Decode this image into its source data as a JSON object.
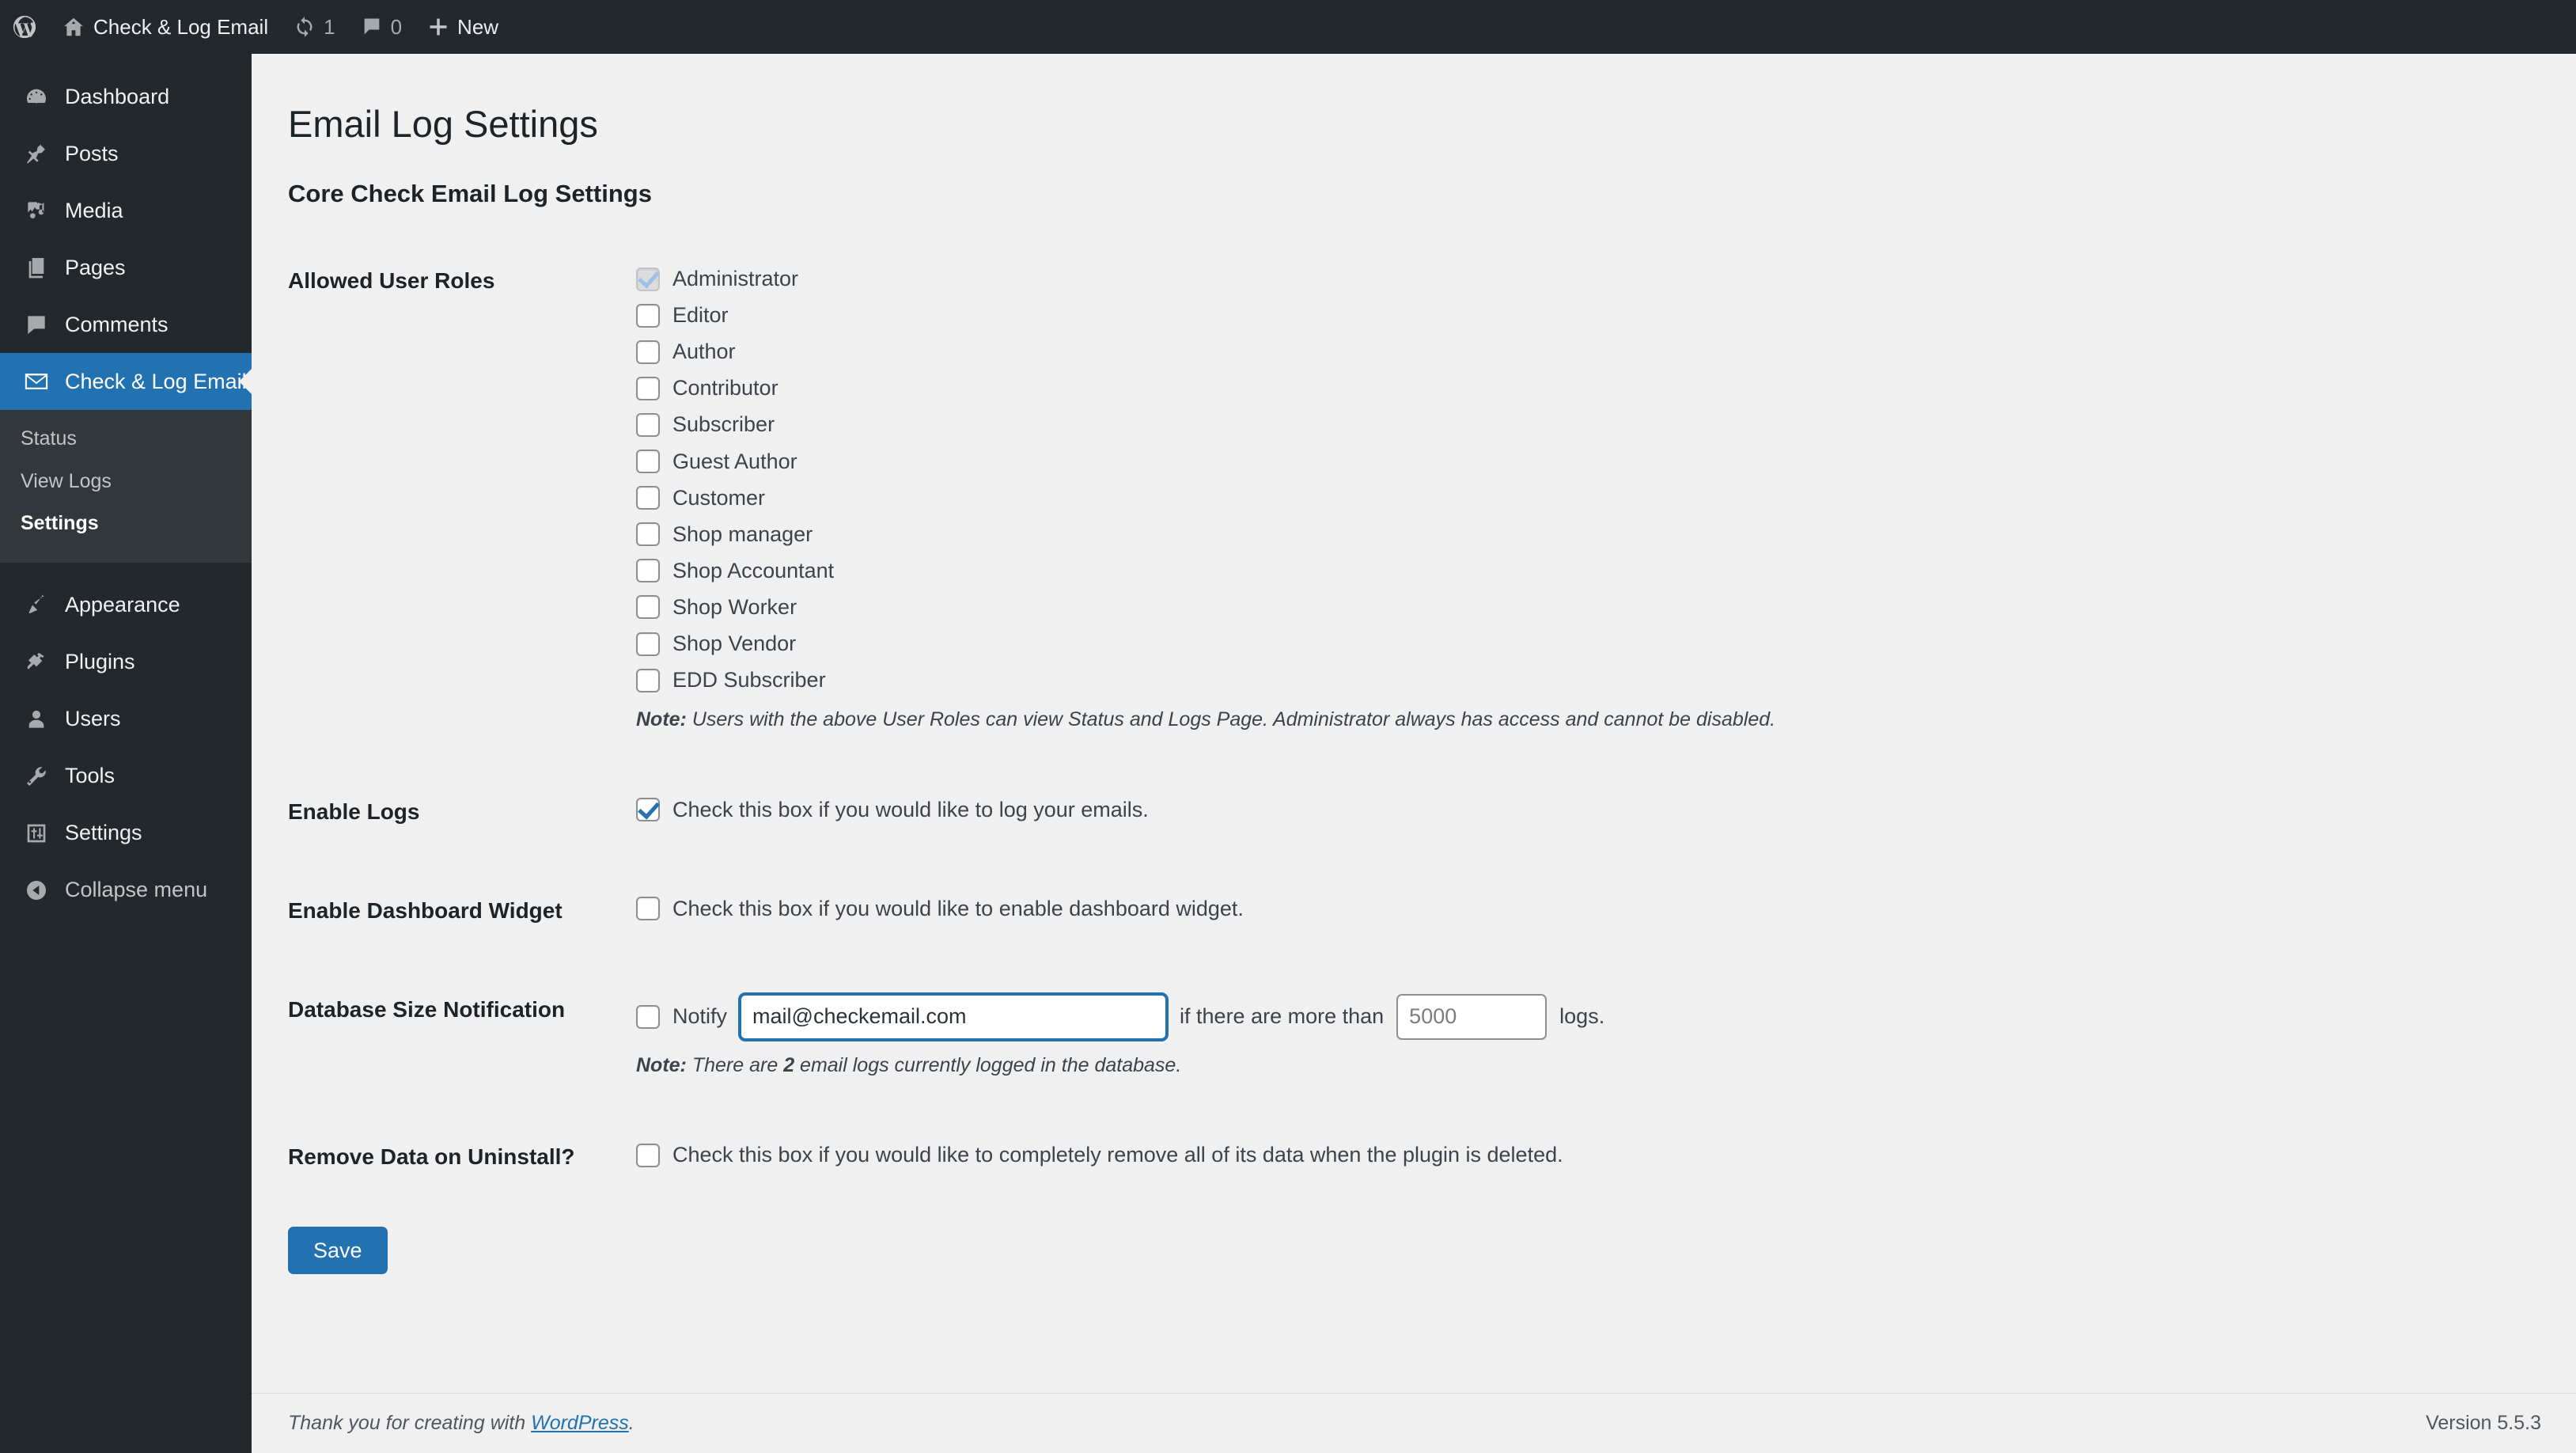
{
  "adminbar": {
    "site_name": "Check & Log Email",
    "updates_count": "1",
    "comments_count": "0",
    "new_label": "New"
  },
  "sidebar": {
    "items": [
      {
        "label": "Dashboard",
        "icon": "dashboard-icon",
        "current": false
      },
      {
        "label": "Posts",
        "icon": "pin-icon",
        "current": false
      },
      {
        "label": "Media",
        "icon": "media-icon",
        "current": false
      },
      {
        "label": "Pages",
        "icon": "pages-icon",
        "current": false
      },
      {
        "label": "Comments",
        "icon": "comments-icon",
        "current": false
      },
      {
        "label": "Check & Log Email",
        "icon": "email-icon",
        "current": true
      },
      {
        "label": "Appearance",
        "icon": "brush-icon",
        "current": false
      },
      {
        "label": "Plugins",
        "icon": "plug-icon",
        "current": false
      },
      {
        "label": "Users",
        "icon": "user-icon",
        "current": false
      },
      {
        "label": "Tools",
        "icon": "wrench-icon",
        "current": false
      },
      {
        "label": "Settings",
        "icon": "sliders-icon",
        "current": false
      }
    ],
    "submenu": [
      {
        "label": "Status",
        "current": false
      },
      {
        "label": "View Logs",
        "current": false
      },
      {
        "label": "Settings",
        "current": true
      }
    ],
    "collapse_label": "Collapse menu"
  },
  "main": {
    "page_title": "Email Log Settings",
    "section_title": "Core Check Email Log Settings",
    "rows": {
      "roles": {
        "label": "Allowed User Roles",
        "options": [
          {
            "label": "Administrator",
            "checked": true,
            "disabled": true
          },
          {
            "label": "Editor",
            "checked": false,
            "disabled": false
          },
          {
            "label": "Author",
            "checked": false,
            "disabled": false
          },
          {
            "label": "Contributor",
            "checked": false,
            "disabled": false
          },
          {
            "label": "Subscriber",
            "checked": false,
            "disabled": false
          },
          {
            "label": "Guest Author",
            "checked": false,
            "disabled": false
          },
          {
            "label": "Customer",
            "checked": false,
            "disabled": false
          },
          {
            "label": "Shop manager",
            "checked": false,
            "disabled": false
          },
          {
            "label": "Shop Accountant",
            "checked": false,
            "disabled": false
          },
          {
            "label": "Shop Worker",
            "checked": false,
            "disabled": false
          },
          {
            "label": "Shop Vendor",
            "checked": false,
            "disabled": false
          },
          {
            "label": "EDD Subscriber",
            "checked": false,
            "disabled": false
          }
        ],
        "note_prefix": "Note:",
        "note_text": "Users with the above User Roles can view Status and Logs Page. Administrator always has access and cannot be disabled."
      },
      "enable_logs": {
        "label": "Enable Logs",
        "checkbox_label": "Check this box if you would like to log your emails.",
        "checked": true
      },
      "dashboard_widget": {
        "label": "Enable Dashboard Widget",
        "checkbox_label": "Check this box if you would like to enable dashboard widget.",
        "checked": false
      },
      "db_notification": {
        "label": "Database Size Notification",
        "checked": false,
        "notify_label": "Notify",
        "email_value": "mail@checkemail.com",
        "middle_label": "if there are more than",
        "threshold_placeholder": "5000",
        "threshold_value": "",
        "suffix_label": "logs.",
        "note_prefix": "Note:",
        "note_before": "There are",
        "note_count": "2",
        "note_after": "email logs currently logged in the database."
      },
      "remove_data": {
        "label": "Remove Data on Uninstall?",
        "checkbox_label": "Check this box if you would like to completely remove all of its data when the plugin is deleted.",
        "checked": false
      }
    },
    "save_label": "Save"
  },
  "footer": {
    "thanks_prefix": "Thank you for creating with",
    "link_label": "WordPress",
    "period": ".",
    "version": "Version 5.5.3"
  },
  "colors": {
    "accent": "#2271b1",
    "sidebar_bg": "#23282d",
    "submenu_bg": "#32373c",
    "content_bg": "#f0f0f1"
  }
}
